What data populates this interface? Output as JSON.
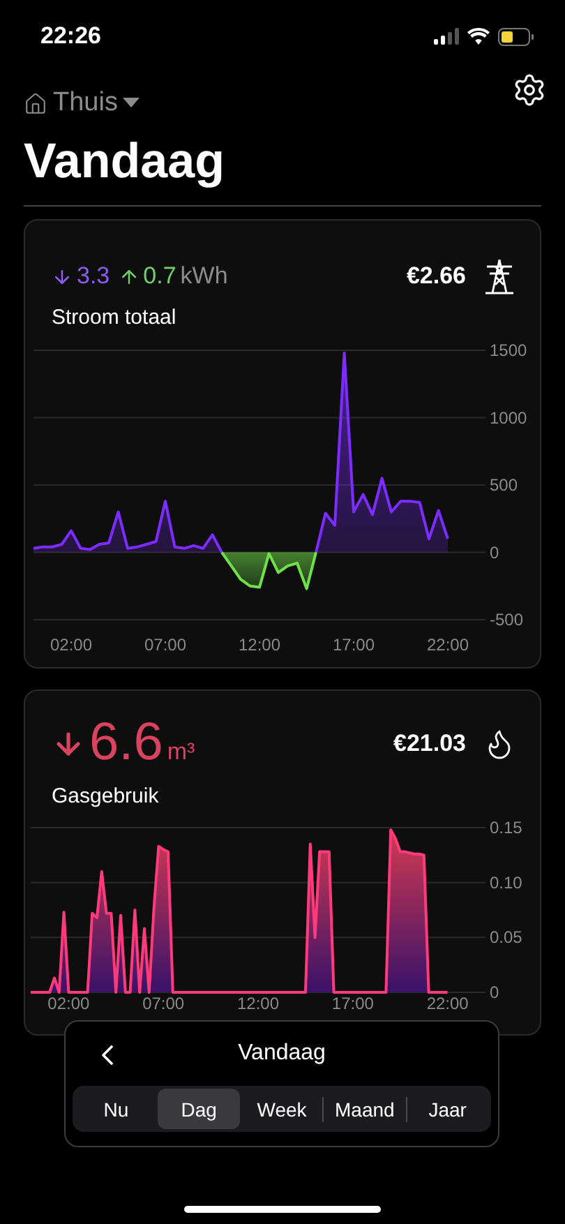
{
  "status_bar": {
    "time": "22:26"
  },
  "header": {
    "location": "Thuis",
    "title": "Vandaag"
  },
  "cards": [
    {
      "kind": "electricity",
      "down": "3.3",
      "up": "0.7",
      "unit": "kWh",
      "cost": "€2.66",
      "label": "Stroom totaal",
      "chart_data": {
        "type": "area",
        "x": [
          0,
          0.5,
          1,
          1.5,
          2,
          2.5,
          3,
          3.5,
          4,
          4.5,
          5,
          5.5,
          6,
          6.5,
          7,
          7.5,
          8,
          8.5,
          9,
          9.5,
          10,
          10.5,
          11,
          11.5,
          12,
          12.5,
          13,
          13.5,
          14,
          14.5,
          15,
          15.5,
          16,
          16.5,
          17,
          17.5,
          18,
          18.5,
          19,
          19.5,
          20,
          20.5,
          21,
          21.5,
          22
        ],
        "xlim": [
          0,
          24
        ],
        "ylim": [
          -500,
          1500
        ],
        "grid": true,
        "series": [
          {
            "color": "#7c2cff",
            "values": [
              30,
              40,
              40,
              60,
              160,
              30,
              20,
              60,
              70,
              300,
              30,
              40,
              60,
              80,
              380,
              40,
              30,
              50,
              30,
              130,
              0,
              null,
              null,
              null,
              null,
              null,
              null,
              null,
              null,
              null,
              0,
              290,
              200,
              1480,
              300,
              430,
              280,
              550,
              300,
              380,
              380,
              370,
              100,
              310,
              100
            ]
          },
          {
            "color": "#6fe04a",
            "values": [
              null,
              null,
              null,
              null,
              null,
              null,
              null,
              null,
              null,
              null,
              null,
              null,
              null,
              null,
              null,
              null,
              null,
              null,
              null,
              null,
              0,
              -100,
              -200,
              -250,
              -260,
              -10,
              -150,
              -100,
              -80,
              -270,
              0,
              null,
              null,
              null,
              null,
              null,
              null,
              null,
              null,
              null,
              null,
              null,
              null,
              null,
              null
            ]
          }
        ],
        "xticks": [
          {
            "value": 2,
            "label": "02:00"
          },
          {
            "value": 7,
            "label": "07:00"
          },
          {
            "value": 12,
            "label": "12:00"
          },
          {
            "value": 17,
            "label": "17:00"
          },
          {
            "value": 22,
            "label": "22:00"
          }
        ],
        "yticks": [
          {
            "value": 1500,
            "label": "1500"
          },
          {
            "value": 1000,
            "label": "1000"
          },
          {
            "value": 500,
            "label": "500"
          },
          {
            "value": 0,
            "label": "0"
          },
          {
            "value": -500,
            "label": "-500"
          }
        ]
      }
    },
    {
      "kind": "gas",
      "down": "6.6",
      "unit": "m³",
      "cost": "€21.03",
      "label": "Gasgebruik",
      "chart_data": {
        "type": "area",
        "x": [
          0,
          0.25,
          0.5,
          0.75,
          1,
          1.25,
          1.5,
          1.75,
          2,
          2.25,
          2.5,
          2.75,
          3,
          3.25,
          3.5,
          3.75,
          4,
          4.25,
          4.5,
          4.75,
          5,
          5.25,
          5.5,
          5.75,
          6,
          6.25,
          6.5,
          6.75,
          7,
          7.25,
          7.5,
          7.75,
          8,
          8.25,
          8.5,
          8.75,
          9,
          9.25,
          9.5,
          9.75,
          10,
          10.25,
          10.5,
          10.75,
          11,
          11.25,
          11.5,
          11.75,
          12,
          12.25,
          12.5,
          12.75,
          13,
          13.25,
          13.5,
          13.75,
          14,
          14.25,
          14.5,
          14.75,
          15,
          15.25,
          15.5,
          15.75,
          16,
          16.25,
          16.5,
          16.75,
          17,
          17.25,
          17.5,
          17.75,
          18,
          18.25,
          18.5,
          18.75,
          19,
          19.25,
          19.5,
          19.75,
          20,
          20.25,
          20.5,
          20.75,
          21,
          21.25,
          21.5,
          21.75,
          22
        ],
        "xlim": [
          0,
          24
        ],
        "ylim": [
          0,
          0.15
        ],
        "grid": true,
        "series": [
          {
            "color": "#ff3a7c",
            "values": [
              0,
              0,
              0,
              0,
              0,
              0.013,
              0,
              0.073,
              0,
              0,
              0,
              0,
              0,
              0.072,
              0.068,
              0.11,
              0.072,
              0.072,
              0,
              0.07,
              0,
              0,
              0.075,
              0,
              0.058,
              0,
              0.076,
              0.133,
              0.13,
              0.128,
              0,
              0,
              0,
              0,
              0,
              0,
              0,
              0,
              0,
              0,
              0,
              0,
              0,
              0,
              0,
              0,
              0,
              0,
              0,
              0,
              0,
              0,
              0,
              0,
              0,
              0,
              0,
              0,
              0,
              0.135,
              0.05,
              0.128,
              0.128,
              0.128,
              0,
              0,
              0,
              0,
              0,
              0,
              0,
              0,
              0,
              0,
              0,
              0,
              0.148,
              0.14,
              0.128,
              0.128,
              0.127,
              0.126,
              0.126,
              0.125,
              0,
              0,
              0,
              0,
              0
            ]
          }
        ],
        "xticks": [
          {
            "value": 2,
            "label": "02:00"
          },
          {
            "value": 7,
            "label": "07:00"
          },
          {
            "value": 12,
            "label": "12:00"
          },
          {
            "value": 17,
            "label": "17:00"
          },
          {
            "value": 22,
            "label": "22:00"
          }
        ],
        "yticks": [
          {
            "value": 0.15,
            "label": "0.15"
          },
          {
            "value": 0.1,
            "label": "0.10"
          },
          {
            "value": 0.05,
            "label": "0.05"
          },
          {
            "value": 0,
            "label": "0"
          }
        ]
      }
    }
  ],
  "period_sheet": {
    "title": "Vandaag",
    "segments": [
      {
        "label": "Nu",
        "selected": false
      },
      {
        "label": "Dag",
        "selected": true
      },
      {
        "label": "Week",
        "selected": false
      },
      {
        "label": "Maand",
        "selected": false
      },
      {
        "label": "Jaar",
        "selected": false
      }
    ]
  }
}
